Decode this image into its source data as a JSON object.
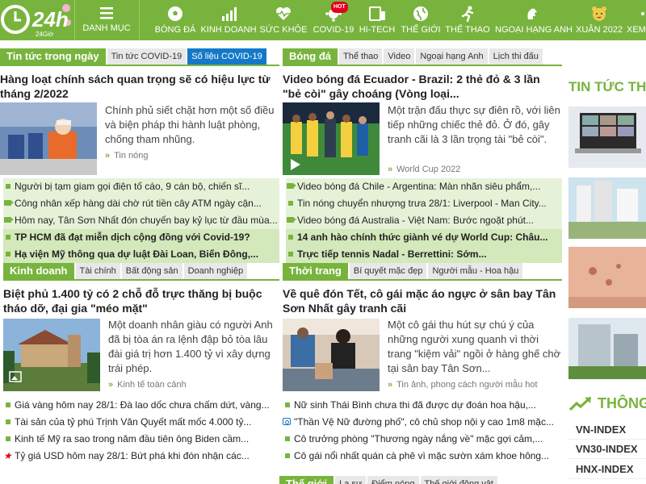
{
  "nav": {
    "logo_text": "24h",
    "logo_sub": "24Giờ",
    "menu_label": "DANH MỤC",
    "items": [
      {
        "label": "BÓNG ĐÁ",
        "icon": "soccer-ball-icon"
      },
      {
        "label": "KINH DOANH",
        "icon": "bar-chart-icon"
      },
      {
        "label": "SỨC KHỎE",
        "icon": "heart-pulse-icon"
      },
      {
        "label": "COVID-19",
        "icon": "virus-icon",
        "badge": "HOT"
      },
      {
        "label": "HI-TECH",
        "icon": "devices-icon"
      },
      {
        "label": "THẾ GIỚI",
        "icon": "globe-icon"
      },
      {
        "label": "THỂ THAO",
        "icon": "runner-icon"
      },
      {
        "label": "NGOẠI HẠNG ANH",
        "icon": "lion-icon"
      },
      {
        "label": "XUÂN 2022",
        "icon": "tiger-icon"
      },
      {
        "label": "XEM",
        "icon": "more-icon"
      }
    ]
  },
  "news": {
    "tabs": [
      "Tin tức trong ngày",
      "Tin tức COVID-19",
      "Số liệu COVID-19"
    ],
    "headline": "Hàng loạt chính sách quan trọng sẽ có hiệu lực từ tháng 2/2022",
    "summary": "Chính phủ siết chặt hơn một số điều và biện pháp thi hành luật phòng, chống tham nhũng.",
    "category": "Tin nóng",
    "links": [
      {
        "text": "Người bị tạm giam gọi điện tố cáo, 9 cán bộ, chiến sĩ...",
        "icon": "bullet"
      },
      {
        "text": "Công nhân xếp hàng dài chờ rút tiền cây ATM ngày cận...",
        "icon": "video-icon"
      },
      {
        "text": "Hôm nay, Tân Sơn Nhất đón chuyến bay kỷ lục từ đầu mùa...",
        "icon": "video-icon"
      },
      {
        "text": "TP HCM đã đạt miễn dịch cộng đồng với Covid-19?",
        "icon": "bullet",
        "style": "hl2"
      },
      {
        "text": "Hạ viện Mỹ thông qua dự luật Đài Loan, Biển Đông,...",
        "icon": "bullet",
        "style": "hl2"
      }
    ]
  },
  "football": {
    "tabs": [
      "Bóng đá",
      "Thể thao",
      "Video",
      "Ngoại hạng Anh",
      "Lịch thi đấu"
    ],
    "headline": "Video bóng đá Ecuador - Brazil: 2 thẻ đỏ & 3 lần \"bẻ còi\" gây choáng (Vòng loại...",
    "summary": "Một trận đấu thực sự điên rồ, với liên tiếp những chiếc thẻ đỏ. Ở đó, gây tranh cãi là 3 lần trọng tài \"bẻ còi\".",
    "category": "World Cup 2022",
    "links": [
      {
        "text": "Video bóng đá Chile - Argentina: Màn nhãn siêu phẩm,...",
        "icon": "video-icon"
      },
      {
        "text": "Tin nóng chuyển nhượng trưa 28/1: Liverpool - Man City...",
        "icon": "bullet"
      },
      {
        "text": "Video bóng đá Australia - Việt Nam: Bước ngoặt phút...",
        "icon": "video-icon"
      },
      {
        "text": "14 anh hào chính thức giành vé dự World Cup: Châu...",
        "icon": "bullet",
        "style": "hl2"
      },
      {
        "text": "Trực tiếp tennis Nadal - Berrettini: Sớm...",
        "icon": "bullet",
        "style": "hl2"
      }
    ]
  },
  "business": {
    "tabs": [
      "Kinh doanh",
      "Tài chính",
      "Bất động sản",
      "Doanh nghiệp"
    ],
    "headline": "Biệt phủ 1.400 tỷ có 2 chỗ đỗ trực thăng bị buộc tháo dỡ, đại gia \"méo mặt\"",
    "summary": "Một doanh nhân giàu có người Anh đã bị tòa án ra lệnh đập bỏ tòa lâu đài giá trị hơn 1.400 tỷ vì xây dựng trái phép.",
    "category": "Kinh tế toàn cảnh",
    "links": [
      {
        "text": "Giá vàng hôm nay 28/1: Đà lao dốc chưa chấm dứt, vàng...",
        "icon": "bullet"
      },
      {
        "text": "Tài sản của tỷ phú Trịnh Văn Quyết mất mốc 4.000 tỷ...",
        "icon": "bullet"
      },
      {
        "text": "Kinh tế Mỹ ra sao trong năm đầu tiên ông Biden cầm...",
        "icon": "bullet"
      },
      {
        "text": "Tỷ giá USD hôm nay 28/1: Bứt phá khi đón nhận các...",
        "icon": "star-icon"
      }
    ]
  },
  "fashion": {
    "tabs": [
      "Thời trang",
      "Bí quyết mặc đẹp",
      "Người mẫu - Hoa hậu"
    ],
    "headline": "Về quê đón Tết, cô gái mặc áo ngực ở sân bay Tân Sơn Nhất gây tranh cãi",
    "summary": "Một cô gái thu hút sự chú ý của những người xung quanh vì thời trang \"kiệm vải\" ngồi ở hàng ghế chờ tại sân bay Tân Sơn...",
    "category": "Tin ảnh, phong cách người mẫu hot",
    "links": [
      {
        "text": "Nữ sinh Thái Bình chưa thi đã được dự đoán hoa hậu,...",
        "icon": "bullet"
      },
      {
        "text": "\"Thần Vệ Nữ đường phố\", cô chủ shop nội y cao 1m8 mặc...",
        "icon": "photo-icon"
      },
      {
        "text": "Cô trưởng phòng \"Thương ngày nắng về\" mặc gợi cảm,...",
        "icon": "bullet"
      },
      {
        "text": "Cô gái nổi nhất quán cà phê vì mặc sườn xám khoe hông...",
        "icon": "bullet"
      }
    ]
  },
  "world": {
    "tabs": [
      "Thế giới",
      "Lạ sự",
      "Điểm nóng",
      "Thế giới động vật"
    ]
  },
  "right": {
    "title": "TIN TỨC TH",
    "market_title": "THÔNG",
    "indexes": [
      "VN-INDEX",
      "VN30-INDEX",
      "HNX-INDEX"
    ]
  },
  "colors": {
    "brand": "#78b43d",
    "accent_blue": "#1479c7",
    "hot": "#e3001b"
  }
}
